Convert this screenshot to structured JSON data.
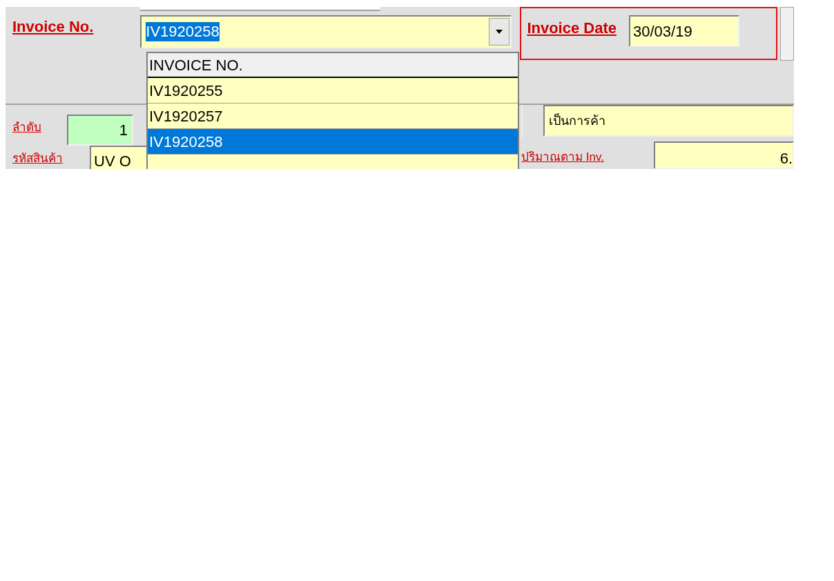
{
  "invoice_no": {
    "label": "Invoice No.",
    "value": "IV1920258",
    "dropdown": {
      "header": "INVOICE NO.",
      "items": [
        {
          "text": "IV1920255",
          "selected": false
        },
        {
          "text": "IV1920257",
          "selected": false
        },
        {
          "text": "IV1920258",
          "selected": true
        }
      ]
    }
  },
  "invoice_date": {
    "label": "Invoice Date",
    "value": "30/03/19"
  },
  "sequence": {
    "label": "ลำดับ",
    "value": "1"
  },
  "product_code": {
    "label": "รหัสสินค้า",
    "value": "UV O"
  },
  "trade_type": {
    "value": "เป็นการค้า"
  },
  "quantity": {
    "label": "ปริมาณตาม Inv.",
    "value": "6."
  }
}
